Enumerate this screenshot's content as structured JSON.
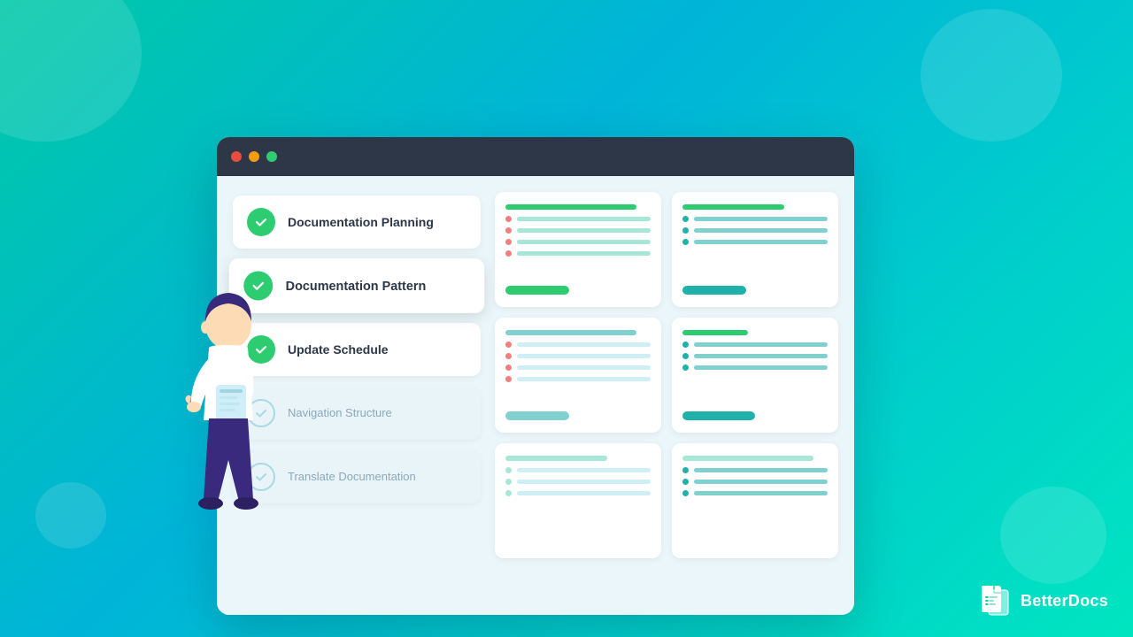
{
  "background": {
    "gradient_start": "#00c9a7",
    "gradient_end": "#00e5c0"
  },
  "browser": {
    "titlebar": {
      "dot1": "red",
      "dot2": "yellow",
      "dot3": "green"
    }
  },
  "checklist": {
    "items": [
      {
        "id": "documentation-planning",
        "label": "Documentation Planning",
        "checked": true,
        "state": "normal"
      },
      {
        "id": "documentation-pattern",
        "label": "Documentation Pattern",
        "checked": true,
        "state": "active"
      },
      {
        "id": "update-schedule",
        "label": "Update Schedule",
        "checked": true,
        "state": "normal"
      },
      {
        "id": "navigation-structure",
        "label": "Navigation Structure",
        "checked": true,
        "state": "faded"
      },
      {
        "id": "translate-documentation",
        "label": "Translate Documentation",
        "checked": true,
        "state": "faded"
      }
    ]
  },
  "branding": {
    "name": "BetterDocs"
  }
}
